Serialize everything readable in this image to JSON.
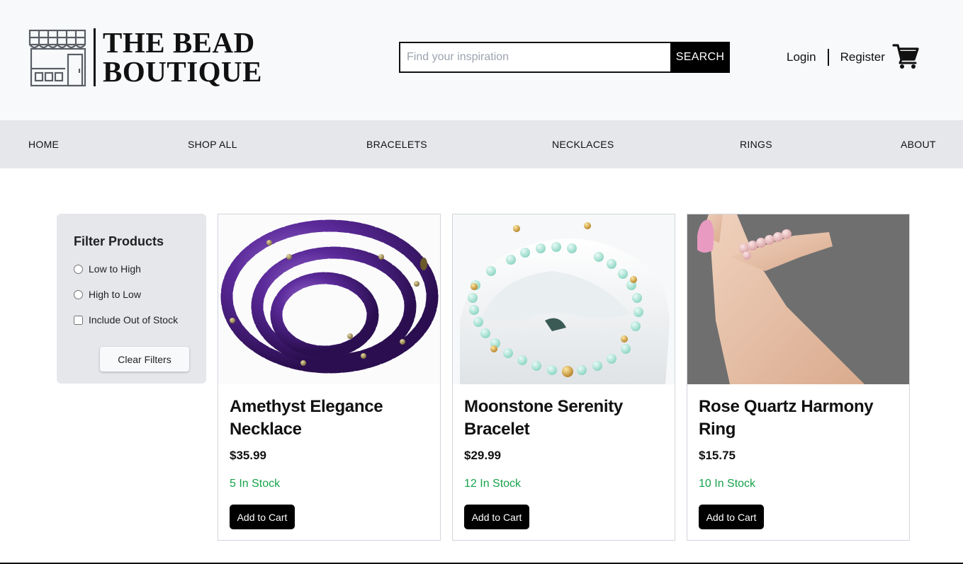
{
  "brand": {
    "line1": "THE BEAD",
    "line2": "BOUTIQUE",
    "logo_icon": "storefront-icon"
  },
  "search": {
    "placeholder": "Find your inspiration",
    "value": "",
    "button_label": "SEARCH"
  },
  "auth": {
    "login_label": "Login",
    "register_label": "Register",
    "cart_icon": "cart-icon"
  },
  "nav": {
    "items": [
      {
        "label": "HOME"
      },
      {
        "label": "SHOP ALL"
      },
      {
        "label": "BRACELETS"
      },
      {
        "label": "NECKLACES"
      },
      {
        "label": "RINGS"
      },
      {
        "label": "ABOUT"
      }
    ]
  },
  "filters": {
    "title": "Filter Products",
    "options": [
      {
        "label": "Low to High",
        "type": "radio",
        "checked": false
      },
      {
        "label": "High to Low",
        "type": "radio",
        "checked": false
      },
      {
        "label": "Include Out of Stock",
        "type": "checkbox",
        "checked": false
      }
    ],
    "clear_label": "Clear Filters"
  },
  "products": [
    {
      "name": "Amethyst Elegance Necklace",
      "price": "$35.99",
      "stock": "5 In Stock",
      "button": "Add to Cart",
      "image": "amethyst-necklace-photo"
    },
    {
      "name": "Moonstone Serenity Bracelet",
      "price": "$29.99",
      "stock": "12 In Stock",
      "button": "Add to Cart",
      "image": "moonstone-bracelet-photo"
    },
    {
      "name": "Rose Quartz Harmony Ring",
      "price": "$15.75",
      "stock": "10 In Stock",
      "button": "Add to Cart",
      "image": "rose-quartz-ring-photo"
    }
  ],
  "colors": {
    "header_bg": "#f8f9fb",
    "nav_bg": "#e5e7eb",
    "stock_green": "#16a34a",
    "button_black": "#000000"
  }
}
